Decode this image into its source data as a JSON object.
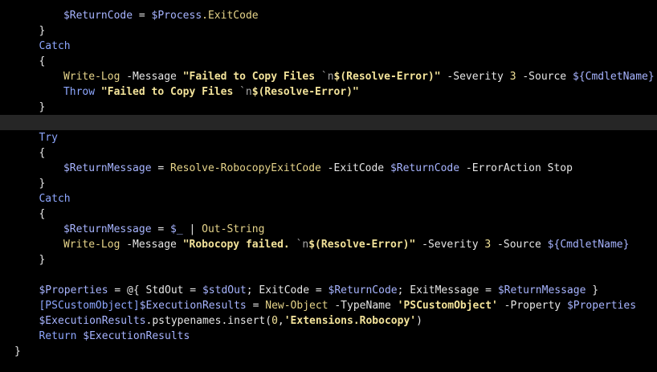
{
  "colors": {
    "background": "#000000",
    "current_line": "#262626",
    "keyword": "#8ea7ff",
    "variable": "#a7b4ff",
    "command": "#e6d48a",
    "string": "#f3e39a",
    "plain": "#e6e6e6"
  },
  "code": {
    "lines": [
      {
        "indent": 8,
        "current": false,
        "tokens": [
          {
            "t": "$ReturnCode",
            "c": "var"
          },
          {
            "t": " = ",
            "c": "plain"
          },
          {
            "t": "$Process",
            "c": "var"
          },
          {
            "t": ".ExitCode",
            "c": "cmd"
          }
        ]
      },
      {
        "indent": 4,
        "current": false,
        "tokens": [
          {
            "t": "}",
            "c": "plain"
          }
        ]
      },
      {
        "indent": 4,
        "current": false,
        "tokens": [
          {
            "t": "Catch",
            "c": "keyword"
          }
        ]
      },
      {
        "indent": 4,
        "current": false,
        "tokens": [
          {
            "t": "{",
            "c": "plain"
          }
        ]
      },
      {
        "indent": 8,
        "current": false,
        "tokens": [
          {
            "t": "Write-Log",
            "c": "cmd"
          },
          {
            "t": " -Message ",
            "c": "param"
          },
          {
            "t": "\"Failed to Copy Files ",
            "c": "string"
          },
          {
            "t": "`n",
            "c": "escape"
          },
          {
            "t": "$(Resolve-Error)\"",
            "c": "string"
          },
          {
            "t": " -Severity ",
            "c": "param"
          },
          {
            "t": "3",
            "c": "number"
          },
          {
            "t": " -Source ",
            "c": "param"
          },
          {
            "t": "${CmdletName}",
            "c": "var"
          }
        ]
      },
      {
        "indent": 8,
        "current": false,
        "tokens": [
          {
            "t": "Throw",
            "c": "keyword"
          },
          {
            "t": " ",
            "c": "plain"
          },
          {
            "t": "\"Failed to Copy Files ",
            "c": "string"
          },
          {
            "t": "`n",
            "c": "escape"
          },
          {
            "t": "$(Resolve-Error)\"",
            "c": "string"
          }
        ]
      },
      {
        "indent": 4,
        "current": false,
        "tokens": [
          {
            "t": "}",
            "c": "plain"
          }
        ]
      },
      {
        "indent": 0,
        "current": true,
        "tokens": []
      },
      {
        "indent": 4,
        "current": false,
        "tokens": [
          {
            "t": "Try",
            "c": "keyword"
          }
        ]
      },
      {
        "indent": 4,
        "current": false,
        "tokens": [
          {
            "t": "{",
            "c": "plain"
          }
        ]
      },
      {
        "indent": 8,
        "current": false,
        "tokens": [
          {
            "t": "$ReturnMessage",
            "c": "var"
          },
          {
            "t": " = ",
            "c": "plain"
          },
          {
            "t": "Resolve-RobocopyExitCode",
            "c": "cmd"
          },
          {
            "t": " -ExitCode ",
            "c": "param"
          },
          {
            "t": "$ReturnCode",
            "c": "var"
          },
          {
            "t": " -ErrorAction Stop",
            "c": "param"
          }
        ]
      },
      {
        "indent": 4,
        "current": false,
        "tokens": [
          {
            "t": "}",
            "c": "plain"
          }
        ]
      },
      {
        "indent": 4,
        "current": false,
        "tokens": [
          {
            "t": "Catch",
            "c": "keyword"
          }
        ]
      },
      {
        "indent": 4,
        "current": false,
        "tokens": [
          {
            "t": "{",
            "c": "plain"
          }
        ]
      },
      {
        "indent": 8,
        "current": false,
        "tokens": [
          {
            "t": "$ReturnMessage",
            "c": "var"
          },
          {
            "t": " = ",
            "c": "plain"
          },
          {
            "t": "$_",
            "c": "var"
          },
          {
            "t": " | ",
            "c": "op"
          },
          {
            "t": "Out-String",
            "c": "cmd"
          }
        ]
      },
      {
        "indent": 8,
        "current": false,
        "tokens": [
          {
            "t": "Write-Log",
            "c": "cmd"
          },
          {
            "t": " -Message ",
            "c": "param"
          },
          {
            "t": "\"Robocopy failed. ",
            "c": "string"
          },
          {
            "t": "`n",
            "c": "escape"
          },
          {
            "t": "$(Resolve-Error)\"",
            "c": "string"
          },
          {
            "t": " -Severity ",
            "c": "param"
          },
          {
            "t": "3",
            "c": "number"
          },
          {
            "t": " -Source ",
            "c": "param"
          },
          {
            "t": "${CmdletName}",
            "c": "var"
          }
        ]
      },
      {
        "indent": 4,
        "current": false,
        "tokens": [
          {
            "t": "}",
            "c": "plain"
          }
        ]
      },
      {
        "indent": 0,
        "current": false,
        "tokens": []
      },
      {
        "indent": 4,
        "current": false,
        "tokens": [
          {
            "t": "$Properties",
            "c": "var"
          },
          {
            "t": " = @{ StdOut = ",
            "c": "plain"
          },
          {
            "t": "$stdOut",
            "c": "var"
          },
          {
            "t": "; ExitCode = ",
            "c": "plain"
          },
          {
            "t": "$ReturnCode",
            "c": "var"
          },
          {
            "t": "; ExitMessage = ",
            "c": "plain"
          },
          {
            "t": "$ReturnMessage",
            "c": "var"
          },
          {
            "t": " }",
            "c": "plain"
          }
        ]
      },
      {
        "indent": 4,
        "current": false,
        "tokens": [
          {
            "t": "[PSCustomObject]",
            "c": "type"
          },
          {
            "t": "$ExecutionResults",
            "c": "var"
          },
          {
            "t": " = ",
            "c": "plain"
          },
          {
            "t": "New-Object",
            "c": "cmd"
          },
          {
            "t": " -TypeName ",
            "c": "param"
          },
          {
            "t": "'PSCustomObject'",
            "c": "string"
          },
          {
            "t": " -Property ",
            "c": "param"
          },
          {
            "t": "$Properties",
            "c": "var"
          }
        ]
      },
      {
        "indent": 4,
        "current": false,
        "tokens": [
          {
            "t": "$ExecutionResults",
            "c": "var"
          },
          {
            "t": ".pstypenames.insert(",
            "c": "plain"
          },
          {
            "t": "0",
            "c": "number"
          },
          {
            "t": ",",
            "c": "plain"
          },
          {
            "t": "'Extensions.Robocopy'",
            "c": "string"
          },
          {
            "t": ")",
            "c": "plain"
          }
        ]
      },
      {
        "indent": 4,
        "current": false,
        "tokens": [
          {
            "t": "Return",
            "c": "keyword"
          },
          {
            "t": " ",
            "c": "plain"
          },
          {
            "t": "$ExecutionResults",
            "c": "var"
          }
        ]
      },
      {
        "indent": 0,
        "current": false,
        "tokens": [
          {
            "t": "}",
            "c": "plain"
          }
        ]
      }
    ]
  }
}
